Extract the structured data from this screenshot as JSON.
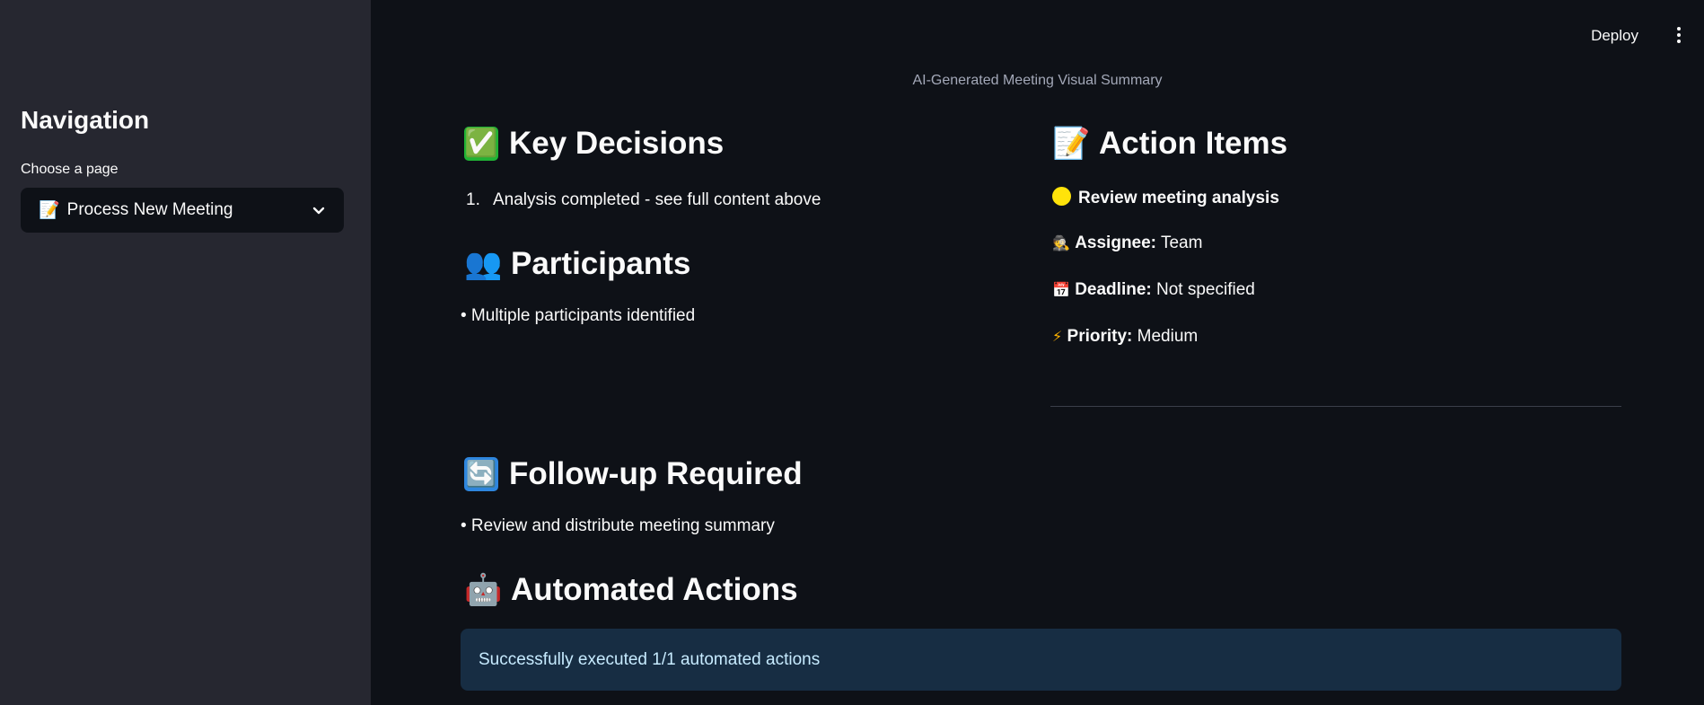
{
  "sidebar": {
    "title": "Navigation",
    "select_label": "Choose a page",
    "select_emoji": "📝",
    "select_value": "Process New Meeting"
  },
  "header": {
    "deploy_label": "Deploy",
    "menu_icon": "kebab-menu-icon"
  },
  "main": {
    "caption": "AI-Generated Meeting Visual Summary",
    "key_decisions": {
      "emoji": "✅",
      "title": "Key Decisions",
      "items": [
        {
          "num": "1.",
          "text": "Analysis completed - see full content above"
        }
      ]
    },
    "participants": {
      "emoji": "👥",
      "title": "Participants",
      "items": [
        "• Multiple participants identified"
      ]
    },
    "action_items": {
      "emoji": "📝",
      "title": "Action Items",
      "item_title": "Review meeting analysis",
      "status_color": "#ffe30a",
      "assignee_emoji": "🕵",
      "assignee_label": "Assignee:",
      "assignee_value": "Team",
      "deadline_emoji": "📅",
      "deadline_label": "Deadline:",
      "deadline_value": "Not specified",
      "priority_emoji": "⚡",
      "priority_label": "Priority:",
      "priority_value": "Medium"
    },
    "follow_up": {
      "emoji": "🔄",
      "title": "Follow-up Required",
      "items": [
        "• Review and distribute meeting summary"
      ]
    },
    "automated": {
      "emoji": "🤖",
      "title": "Automated Actions",
      "message": "Successfully executed 1/1 automated actions"
    }
  },
  "colors": {
    "app_bg": "#0e1117",
    "sidebar_bg": "#262730",
    "info_bg": "#172d43",
    "info_text": "#c7ebff"
  }
}
